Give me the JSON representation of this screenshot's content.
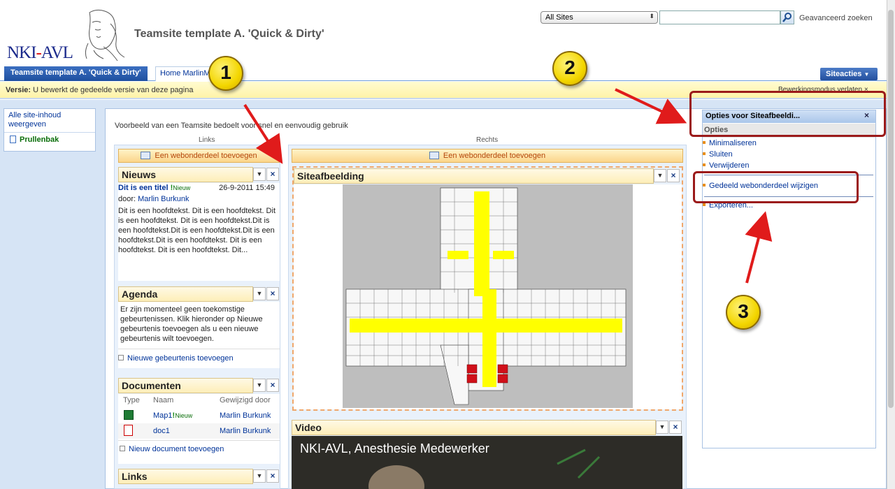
{
  "header": {
    "logo_text_part1": "NKI",
    "logo_dash": "-",
    "logo_text_part2": "AVL",
    "site_title": "Teamsite template A. 'Quick & Dirty'",
    "search_scope": "All Sites",
    "search_placeholder": "",
    "advanced_search": "Geavanceerd zoeken"
  },
  "topnav": {
    "active_tab": "Teamsite template A. 'Quick & Dirty'",
    "home_tab": "Home MarlinM",
    "site_actions": "Siteacties"
  },
  "version_bar": {
    "label": "Versie:",
    "text": "U bewerkt de gedeelde versie van deze pagina",
    "edit_mode_exit": "Bewerkingsmodus verlaten"
  },
  "quicklaunch": {
    "view_all": "Alle site-inhoud weergeven",
    "recycle_bin": "Prullenbak"
  },
  "main": {
    "intro": "Voorbeeld van een Teamsite bedoelt voor snel en eenvoudig gebruik",
    "zone_left_label": "Links",
    "zone_right_label": "Rechts",
    "add_webpart": "Een webonderdeel toevoegen"
  },
  "nieuws": {
    "title": "Nieuws",
    "item_title": "Dit is een titel",
    "new_badge": "Nieuw",
    "date": "26-9-2011 15:49",
    "by_label": "door:",
    "author": "Marlin Burkunk",
    "body": "Dit is een hoofdtekst. Dit is een hoofdtekst. Dit is een hoofdtekst. Dit is een hoofdtekst.Dit is een hoofdtekst.Dit is een hoofdtekst.Dit is een hoofdtekst.Dit is een hoofdtekst. Dit is een hoofdtekst. Dit is een hoofdtekst. Dit..."
  },
  "agenda": {
    "title": "Agenda",
    "body": "Er zijn momenteel geen toekomstige gebeurtenissen. Klik hieronder op Nieuwe gebeurtenis toevoegen als u een nieuwe gebeurtenis wilt toevoegen.",
    "add_link": "Nieuwe gebeurtenis toevoegen"
  },
  "documenten": {
    "title": "Documenten",
    "col_type": "Type",
    "col_name": "Naam",
    "col_modified": "Gewijzigd door",
    "rows": [
      {
        "name": "Map1",
        "badge": "Nieuw",
        "modified_by": "Marlin Burkunk"
      },
      {
        "name": "doc1",
        "badge": "",
        "modified_by": "Marlin Burkunk"
      }
    ],
    "add_link": "Nieuw document toevoegen"
  },
  "links_wp": {
    "title": "Links"
  },
  "siteafbeelding": {
    "title": "Siteafbeelding"
  },
  "video": {
    "title": "Video",
    "caption": "NKI-AVL, Anesthesie Medewerker"
  },
  "toolpane": {
    "title": "Opties voor Siteafbeeldi...",
    "close": "×",
    "section": "Opties",
    "items": [
      "Minimaliseren",
      "Sluiten",
      "Verwijderen",
      "Gedeeld webonderdeel wijzigen",
      "Exporteren..."
    ]
  },
  "callouts": [
    "1",
    "2",
    "3"
  ],
  "colors": {
    "accent": "#1e4f9f",
    "highlight_box": "#9b1a1a",
    "callout_fill": "#f3d600",
    "arrow": "#e01b1b"
  }
}
